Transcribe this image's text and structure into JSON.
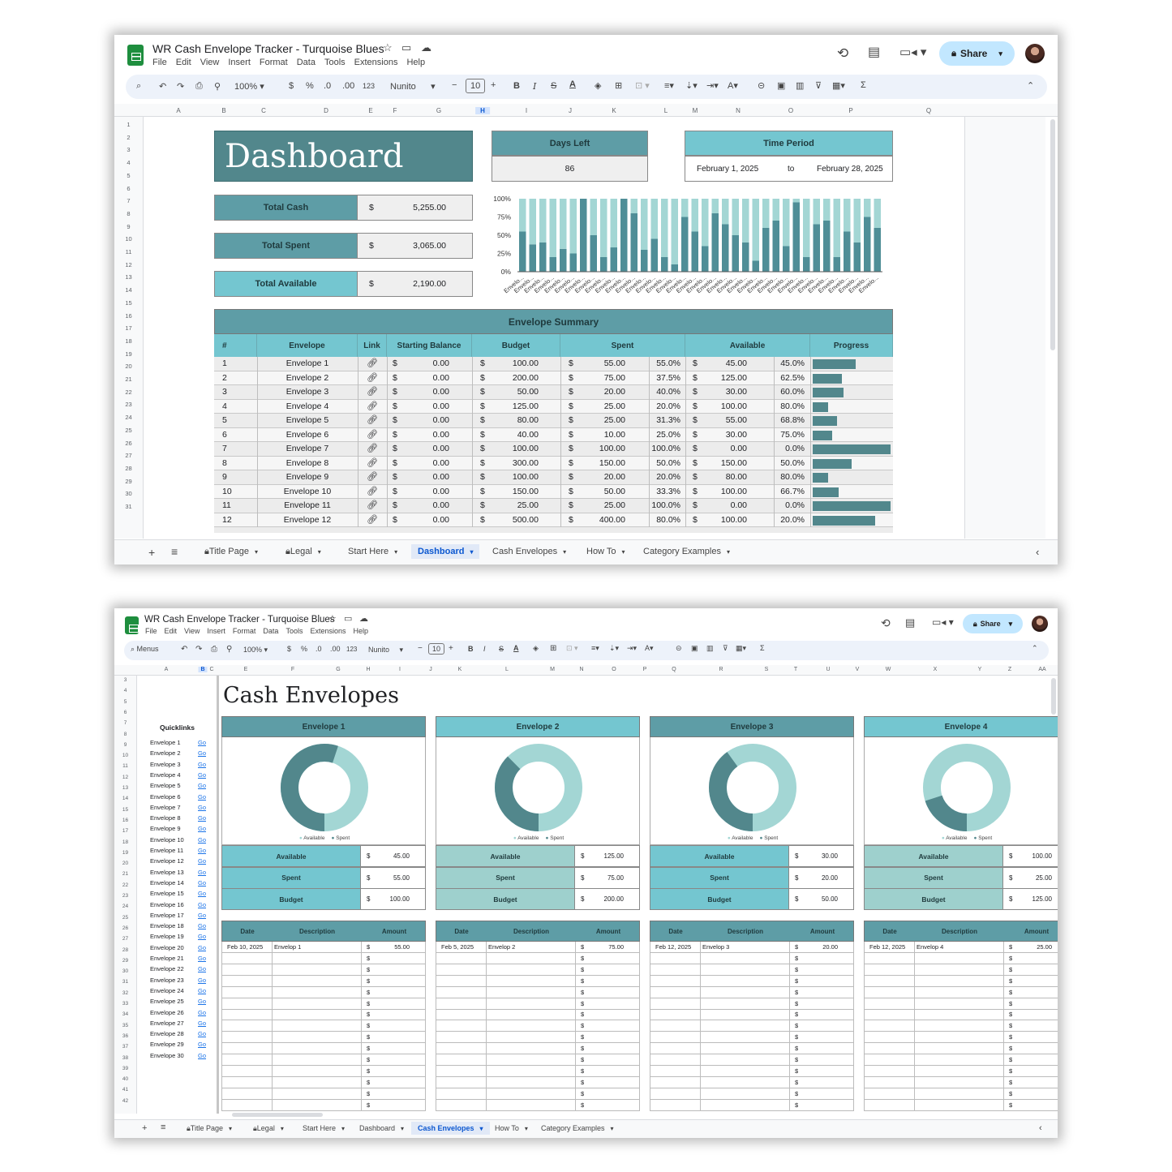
{
  "top": {
    "doc_title": "WR Cash Envelope Tracker - Turquoise Blues",
    "menus": [
      "File",
      "Edit",
      "View",
      "Insert",
      "Format",
      "Data",
      "Tools",
      "Extensions",
      "Help"
    ],
    "zoom": "100%",
    "font": "Nunito",
    "font_size": "10",
    "share_label": "Share",
    "format_123": "123",
    "columns": [
      "A",
      "B",
      "C",
      "D",
      "E",
      "F",
      "G",
      "H",
      "I",
      "J",
      "K",
      "L",
      "M",
      "N",
      "O",
      "P",
      "Q"
    ],
    "rows": [
      "1",
      "2",
      "3",
      "4",
      "5",
      "6",
      "7",
      "8",
      "9",
      "10",
      "11",
      "12",
      "13",
      "14",
      "15",
      "16",
      "17",
      "18",
      "19",
      "20",
      "21",
      "22",
      "23",
      "24",
      "25",
      "26",
      "27",
      "28",
      "29",
      "30",
      "31"
    ],
    "dashboard_title": "Dashboard",
    "days_left_label": "Days Left",
    "days_left_value": "86",
    "time_period_label": "Time Period",
    "period_start": "February 1, 2025",
    "period_to": "to",
    "period_end": "February 28, 2025",
    "summary": [
      {
        "label": "Total Cash",
        "currency": "$",
        "value": "5,255.00"
      },
      {
        "label": "Total Spent",
        "currency": "$",
        "value": "3,065.00"
      },
      {
        "label": "Total Available",
        "currency": "$",
        "value": "2,190.00"
      }
    ],
    "table_title": "Envelope Summary",
    "headers": [
      "#",
      "Envelope",
      "Link",
      "Starting Balance",
      "Budget",
      "Spent",
      "Available",
      "Progress"
    ],
    "currency": "$",
    "link_icon": "link-icon",
    "rows_data": [
      {
        "n": "1",
        "name": "Envelope 1",
        "start": "0.00",
        "budget": "100.00",
        "spent": "55.00",
        "spent_pct": "55.0%",
        "avail": "45.00",
        "avail_pct": "45.0%",
        "progress": 0.55
      },
      {
        "n": "2",
        "name": "Envelope 2",
        "start": "0.00",
        "budget": "200.00",
        "spent": "75.00",
        "spent_pct": "37.5%",
        "avail": "125.00",
        "avail_pct": "62.5%",
        "progress": 0.375
      },
      {
        "n": "3",
        "name": "Envelope 3",
        "start": "0.00",
        "budget": "50.00",
        "spent": "20.00",
        "spent_pct": "40.0%",
        "avail": "30.00",
        "avail_pct": "60.0%",
        "progress": 0.4
      },
      {
        "n": "4",
        "name": "Envelope 4",
        "start": "0.00",
        "budget": "125.00",
        "spent": "25.00",
        "spent_pct": "20.0%",
        "avail": "100.00",
        "avail_pct": "80.0%",
        "progress": 0.2
      },
      {
        "n": "5",
        "name": "Envelope 5",
        "start": "0.00",
        "budget": "80.00",
        "spent": "25.00",
        "spent_pct": "31.3%",
        "avail": "55.00",
        "avail_pct": "68.8%",
        "progress": 0.313
      },
      {
        "n": "6",
        "name": "Envelope 6",
        "start": "0.00",
        "budget": "40.00",
        "spent": "10.00",
        "spent_pct": "25.0%",
        "avail": "30.00",
        "avail_pct": "75.0%",
        "progress": 0.25
      },
      {
        "n": "7",
        "name": "Envelope 7",
        "start": "0.00",
        "budget": "100.00",
        "spent": "100.00",
        "spent_pct": "100.0%",
        "avail": "0.00",
        "avail_pct": "0.0%",
        "progress": 1.0
      },
      {
        "n": "8",
        "name": "Envelope 8",
        "start": "0.00",
        "budget": "300.00",
        "spent": "150.00",
        "spent_pct": "50.0%",
        "avail": "150.00",
        "avail_pct": "50.0%",
        "progress": 0.5
      },
      {
        "n": "9",
        "name": "Envelope 9",
        "start": "0.00",
        "budget": "100.00",
        "spent": "20.00",
        "spent_pct": "20.0%",
        "avail": "80.00",
        "avail_pct": "80.0%",
        "progress": 0.2
      },
      {
        "n": "10",
        "name": "Envelope 10",
        "start": "0.00",
        "budget": "150.00",
        "spent": "50.00",
        "spent_pct": "33.3%",
        "avail": "100.00",
        "avail_pct": "66.7%",
        "progress": 0.333
      },
      {
        "n": "11",
        "name": "Envelope 11",
        "start": "0.00",
        "budget": "25.00",
        "spent": "25.00",
        "spent_pct": "100.0%",
        "avail": "0.00",
        "avail_pct": "0.0%",
        "progress": 1.0
      },
      {
        "n": "12",
        "name": "Envelope 12",
        "start": "0.00",
        "budget": "500.00",
        "spent": "400.00",
        "spent_pct": "80.0%",
        "avail": "100.00",
        "avail_pct": "20.0%",
        "progress": 0.8
      }
    ],
    "tabs": [
      "Title Page",
      "Legal",
      "Start Here",
      "Dashboard",
      "Cash Envelopes",
      "How To",
      "Category Examples"
    ],
    "active_tab": "Dashboard"
  },
  "chart_data": {
    "type": "bar",
    "stacked": "100%",
    "ytick_labels": [
      "100%",
      "75%",
      "50%",
      "25%",
      "0%"
    ],
    "category_label": "Envelo...",
    "series": [
      {
        "name": "",
        "color": "#4f8e97",
        "values": [
          0.55,
          0.375,
          0.4,
          0.2,
          0.313,
          0.25,
          1.0,
          0.5,
          0.2,
          0.333,
          1.0,
          0.8,
          0.3,
          0.45,
          0.2,
          0.1,
          0.75,
          0.55,
          0.35,
          0.8,
          0.65,
          0.5,
          0.4,
          0.15,
          0.6,
          0.7,
          0.35,
          0.95,
          0.2,
          0.65,
          0.7,
          0.2,
          0.55,
          0.4,
          0.75,
          0.6
        ]
      },
      {
        "name": "",
        "color": "#a3d6d4",
        "values": [
          0.45,
          0.625,
          0.6,
          0.8,
          0.687,
          0.75,
          0.0,
          0.5,
          0.8,
          0.667,
          0.0,
          0.2,
          0.7,
          0.55,
          0.8,
          0.9,
          0.25,
          0.45,
          0.65,
          0.2,
          0.35,
          0.5,
          0.6,
          0.85,
          0.4,
          0.3,
          0.65,
          0.05,
          0.8,
          0.35,
          0.3,
          0.8,
          0.45,
          0.6,
          0.25,
          0.4
        ]
      }
    ]
  },
  "bottom": {
    "doc_title": "WR Cash Envelope Tracker - Turquoise Blues",
    "menus": [
      "File",
      "Edit",
      "View",
      "Insert",
      "Format",
      "Data",
      "Tools",
      "Extensions",
      "Help"
    ],
    "search_label": "Menus",
    "zoom": "100%",
    "font": "Nunito",
    "font_size": "10",
    "share_label": "Share",
    "format_123": "123",
    "columns": [
      "A",
      "B",
      "C",
      "E",
      "F",
      "G",
      "H",
      "I",
      "J",
      "K",
      "L",
      "M",
      "N",
      "O",
      "P",
      "Q",
      "R",
      "S",
      "T",
      "U",
      "V",
      "W",
      "X",
      "Y",
      "Z",
      "AA"
    ],
    "rows": [
      "3",
      "4",
      "5",
      "6",
      "7",
      "8",
      "9",
      "10",
      "11",
      "12",
      "13",
      "14",
      "15",
      "16",
      "17",
      "18",
      "19",
      "20",
      "21",
      "22",
      "23",
      "24",
      "25",
      "26",
      "27",
      "28",
      "29",
      "30",
      "31",
      "32",
      "33",
      "34",
      "35",
      "36",
      "37",
      "38",
      "39",
      "40",
      "41",
      "42"
    ],
    "sheet_title": "Cash Envelopes",
    "quicklinks_label": "Quicklinks",
    "go_label": "Go",
    "quicklinks": [
      "Envelope 1",
      "Envelope 2",
      "Envelope 3",
      "Envelope 4",
      "Envelope 5",
      "Envelope 6",
      "Envelope 7",
      "Envelope 8",
      "Envelope 9",
      "Envelope 10",
      "Envelope 11",
      "Envelope 12",
      "Envelope 13",
      "Envelope 14",
      "Envelope 15",
      "Envelope 16",
      "Envelope 17",
      "Envelope 18",
      "Envelope 19",
      "Envelope 20",
      "Envelope 21",
      "Envelope 22",
      "Envelope 23",
      "Envelope 24",
      "Envelope 25",
      "Envelope 26",
      "Envelope 27",
      "Envelope 28",
      "Envelope 29",
      "Envelope 30"
    ],
    "legend_available": "Available",
    "legend_spent": "Spent",
    "label_available": "Available",
    "label_spent": "Spent",
    "label_budget": "Budget",
    "col_date": "Date",
    "col_desc": "Description",
    "col_amount": "Amount",
    "currency": "$",
    "envelopes": [
      {
        "title": "Envelope 1",
        "available": "45.00",
        "spent": "55.00",
        "budget": "100.00",
        "spent_frac": 0.55,
        "date": "Feb 10, 2025",
        "desc": "Envelop 1",
        "amount": "55.00"
      },
      {
        "title": "Envelope 2",
        "available": "125.00",
        "spent": "75.00",
        "budget": "200.00",
        "spent_frac": 0.375,
        "date": "Feb 5, 2025",
        "desc": "Envelop 2",
        "amount": "75.00"
      },
      {
        "title": "Envelope 3",
        "available": "30.00",
        "spent": "20.00",
        "budget": "50.00",
        "spent_frac": 0.4,
        "date": "Feb 12, 2025",
        "desc": "Envelop 3",
        "amount": "20.00"
      },
      {
        "title": "Envelope 4",
        "available": "100.00",
        "spent": "25.00",
        "budget": "125.00",
        "spent_frac": 0.2,
        "date": "Feb 12, 2025",
        "desc": "Envelop 4",
        "amount": "25.00"
      }
    ],
    "tabs": [
      "Title Page",
      "Legal",
      "Start Here",
      "Dashboard",
      "Cash Envelopes",
      "How To",
      "Category Examples"
    ],
    "active_tab": "Cash Envelopes"
  },
  "colors": {
    "dark_teal": "#52878c",
    "mid_teal": "#5e9da6",
    "light_teal": "#74c6d0",
    "pale_teal": "#9ed0cd",
    "bar_dark": "#4f8e97",
    "bar_light": "#a3d6d4"
  }
}
